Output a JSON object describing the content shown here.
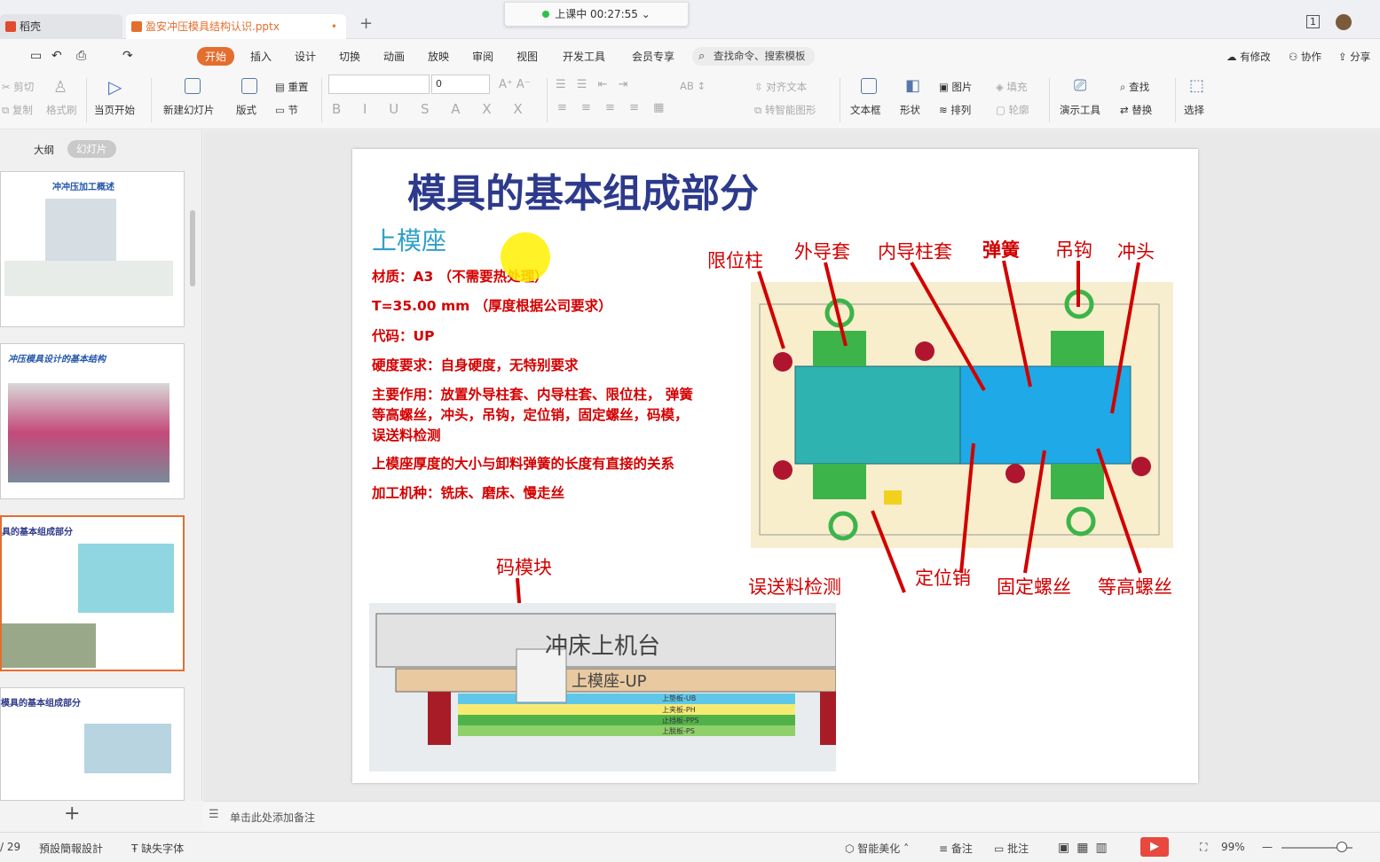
{
  "titlebar": {
    "tabs": [
      {
        "label": "稻壳",
        "icon": "docer-icon"
      },
      {
        "label": "盈安冲压模具结构认识.pptx",
        "icon": "ppt-icon",
        "modified": "•"
      }
    ],
    "new_tab": "+",
    "timer": "上课中 00:27:55",
    "page_badge": "1"
  },
  "menubar": {
    "items": [
      "开始",
      "插入",
      "设计",
      "切换",
      "动画",
      "放映",
      "审阅",
      "视图",
      "开发工具",
      "会员专享"
    ],
    "search_placeholder": "查找命令、搜索模板",
    "right": [
      "有修改",
      "协作",
      "分享"
    ]
  },
  "ribbon": {
    "cut": "剪切",
    "copy": "复制",
    "format_painter": "格式刷",
    "play_from_current": "当页开始",
    "new_slide": "新建幻灯片",
    "layout": "版式",
    "reset": "重置",
    "section": "节",
    "font_size": "0",
    "text_box": "文本框",
    "shapes": "形状",
    "picture": "图片",
    "fill": "填充",
    "arrange": "排列",
    "outline": "轮廓",
    "align_text": "对齐文本",
    "convert_smartart": "转智能图形",
    "presentation_tools": "演示工具",
    "find": "查找",
    "replace": "替换",
    "select": "选择"
  },
  "leftpanel": {
    "outline_tab": "大纲",
    "slides_tab": "幻灯片",
    "thumbs": [
      {
        "title": "冲冲压加工概述"
      },
      {
        "title": "冲压模具设计的基本结构"
      },
      {
        "title": "具的基本组成部分"
      },
      {
        "title": "模具的基本组成部分"
      }
    ],
    "add": "+"
  },
  "slide": {
    "title": "模具的基本组成部分",
    "subtitle": "上模座",
    "lines": [
      "材质：A3 （不需要热处理）",
      "T=35.00 mm （厚度根据公司要求）",
      "代码：UP",
      "硬度要求：自身硬度，无特别要求",
      "主要作用：放置外导柱套、内导柱套、限位柱， 弹簧",
      "等高螺丝，冲头，吊钩，定位销，固定螺丝，码模，",
      "误送料检测",
      "上模座厚度的大小与卸料弹簧的长度有直接的关系",
      "加工机种：铣床、磨床、慢走丝"
    ],
    "labels": {
      "limit_post": "限位柱",
      "outer_guide": "外导套",
      "inner_guide": "内导柱套",
      "spring": "弹簧",
      "hook": "吊钩",
      "punch": "冲头",
      "misfeed": "误送料检测",
      "dowel": "定位销",
      "fix_screw": "固定螺丝",
      "shoulder_screw": "等高螺丝",
      "clamp_block": "码模块"
    },
    "section": {
      "press_upper": "冲床上机台",
      "upper_die": "上模座-UP",
      "plates": [
        "上垫板-UB",
        "上夹板-PH",
        "止挡板-PPS",
        "上脱板-PS"
      ]
    }
  },
  "notes": {
    "placeholder": "单击此处添加备注"
  },
  "statusbar": {
    "page": "/ 29",
    "theme": "預設簡報設計",
    "missing_font": "缺失字体",
    "beautify": "智能美化",
    "notes": "备注",
    "comments": "批注",
    "zoom": "99%"
  },
  "colors": {
    "accent": "#e46e2e",
    "slide_title": "#2d3a8c",
    "slide_text": "#d40000",
    "subtitle": "#2fa0c8"
  }
}
